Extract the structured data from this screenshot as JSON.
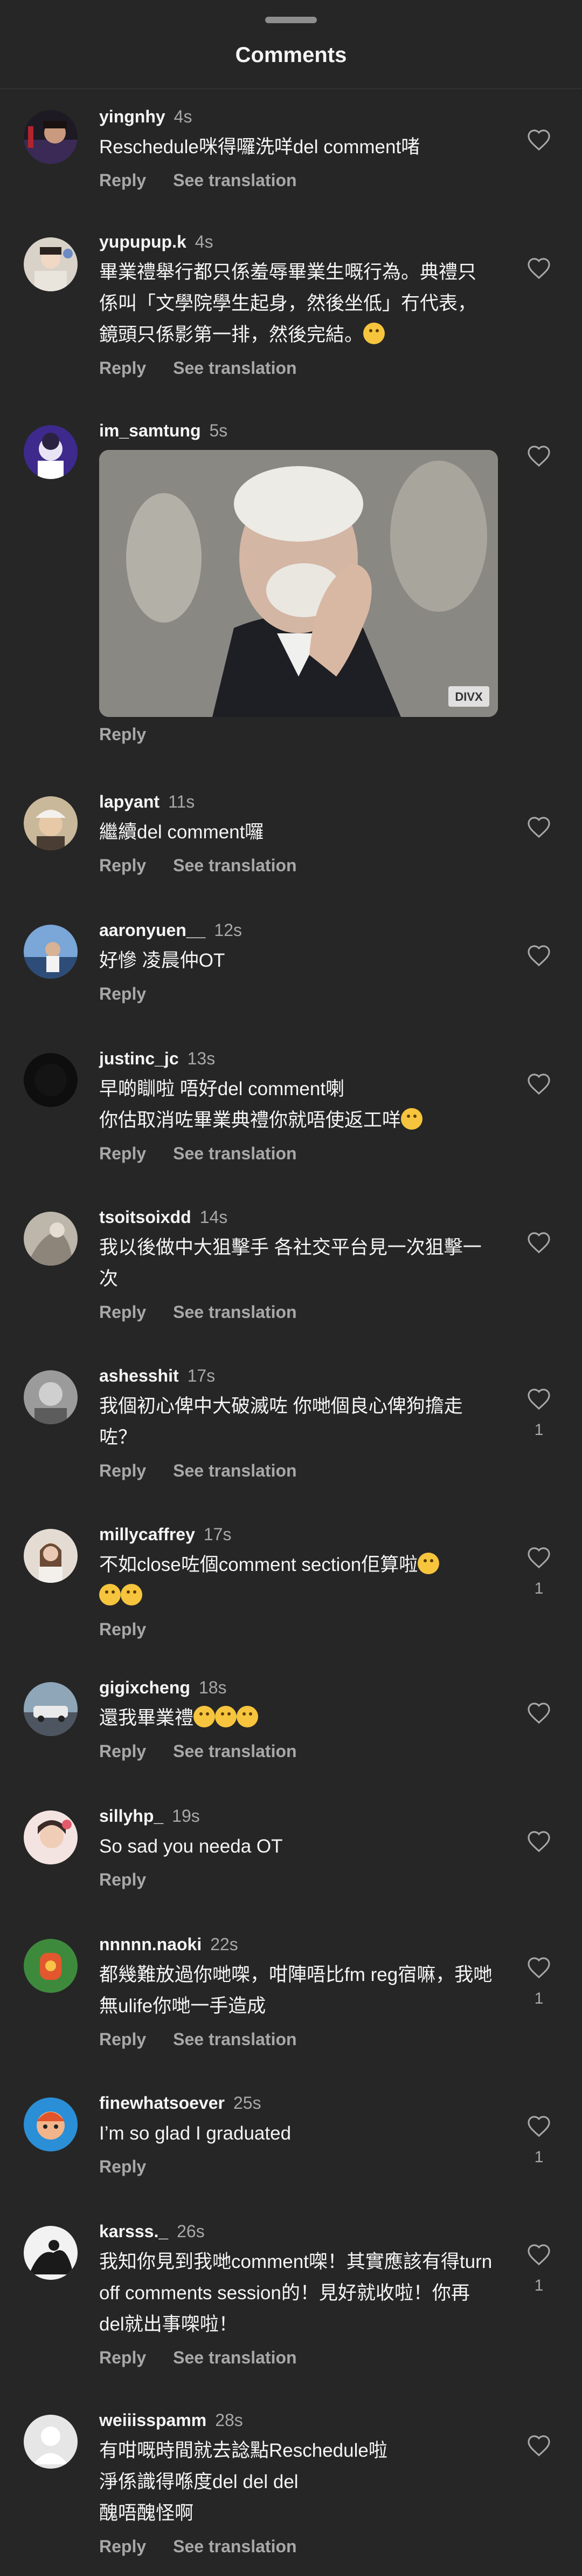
{
  "sheet": {
    "title": "Comments"
  },
  "labels": {
    "reply": "Reply",
    "see_translation": "See translation"
  },
  "comments": [
    {
      "user": "yingnhy",
      "time": "4s",
      "text": "Reschedule咪得囉洗咩del comment啫",
      "likes": ""
    },
    {
      "user": "yupupup.k",
      "time": "4s",
      "text": "畢業禮舉行都只係羞辱畢業生嘅行為。典禮只係叫「文學院學生起身，然後坐低」冇代表，鏡頭只係影第一排，然後完結。",
      "likes": ""
    },
    {
      "user": "im_samtung",
      "time": "5s",
      "text": "",
      "gif_watermark": "DIVX",
      "likes": ""
    },
    {
      "user": "lapyant",
      "time": "11s",
      "text": "繼續del comment囉",
      "likes": ""
    },
    {
      "user": "aaronyuen__",
      "time": "12s",
      "text": "好慘 凌晨仲OT",
      "likes": ""
    },
    {
      "user": "justinc_jc",
      "time": "13s",
      "text": "早啲瞓啦 唔好del comment喇",
      "text2": "你估取消咗畢業典禮你就唔使返工咩",
      "likes": ""
    },
    {
      "user": "tsoitsoixdd",
      "time": "14s",
      "text": "我以後做中大狙擊手 各社交平台見一次狙擊一次",
      "likes": ""
    },
    {
      "user": "ashesshit",
      "time": "17s",
      "text": "我個初心俾中大破滅咗 你哋個良心俾狗擔走咗？",
      "likes": "1"
    },
    {
      "user": "millycaffrey",
      "time": "17s",
      "text": "不如close咗個comment section佢算啦",
      "likes": "1"
    },
    {
      "user": "gigixcheng",
      "time": "18s",
      "text": "還我畢業禮",
      "likes": ""
    },
    {
      "user": "sillyhp_",
      "time": "19s",
      "text": "So sad you needa OT",
      "likes": ""
    },
    {
      "user": "nnnnn.naoki",
      "time": "22s",
      "text": "都幾難放過你哋㗎，咁陣唔比fm reg宿嘛，我哋無ulife你哋一手造成",
      "likes": "1"
    },
    {
      "user": "finewhatsoever",
      "time": "25s",
      "text": "I’m so glad I graduated",
      "likes": "1"
    },
    {
      "user": "karsss._",
      "time": "26s",
      "text": "我知你見到我哋comment㗎！其實應該有得turn off comments session的！見好就收啦！你再del就出事㗎啦！",
      "likes": "1"
    },
    {
      "user": "weiiisspamm",
      "time": "28s",
      "text": "有咁嘅時間就去諗點Reschedule啦",
      "text2": "淨係識得喺度del del del",
      "text3": "醜唔醜怪啊",
      "likes": ""
    }
  ]
}
